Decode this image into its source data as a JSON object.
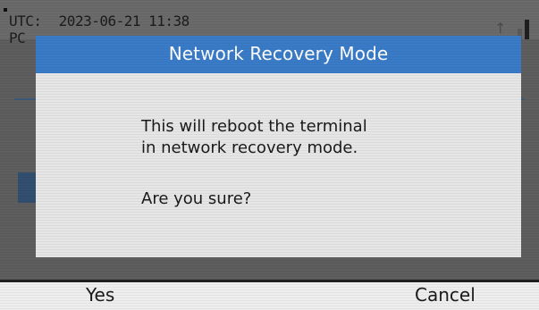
{
  "status_bar": {
    "utc_label": "UTC:",
    "datetime": "2023-06-21  11:38",
    "line2_fragment": "PC",
    "icons": [
      "upload-arrow-icon",
      "signal-bars-icon"
    ]
  },
  "dialog": {
    "title": "Network Recovery Mode",
    "message_line1": "This will reboot the terminal",
    "message_line2": "in network recovery mode.",
    "question": "Are you sure?"
  },
  "softkeys": {
    "left_label": "Yes",
    "right_label": "Cancel"
  },
  "colors": {
    "dialog_header": "#3a7bc8",
    "dialog_background": "#e6e6e6",
    "screen_background": "#5e5e5e",
    "softkey_bar": "#eeeeee",
    "highlight_row": "#324f70"
  }
}
